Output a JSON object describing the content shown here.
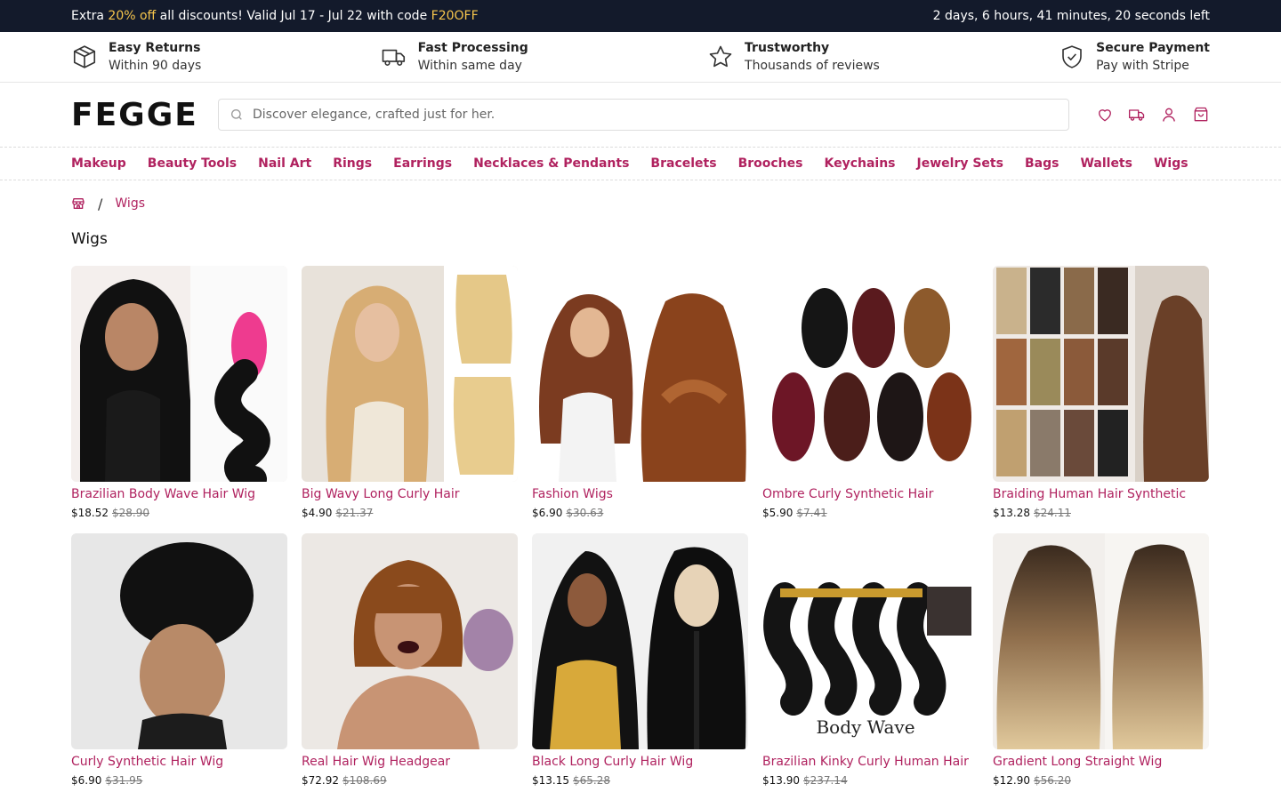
{
  "promo": {
    "pre": "Extra ",
    "discount": "20% off",
    "mid": " all discounts! Valid Jul 17 - Jul 22 with code ",
    "code": "F20OFF",
    "countdown": "2 days, 6 hours, 41 minutes, 20 seconds left"
  },
  "features": [
    {
      "title": "Easy Returns",
      "sub": "Within 90 days",
      "icon": "box-icon"
    },
    {
      "title": "Fast Processing",
      "sub": "Within same day",
      "icon": "truck-icon"
    },
    {
      "title": "Trustworthy",
      "sub": "Thousands of reviews",
      "icon": "star-icon"
    },
    {
      "title": "Secure Payment",
      "sub": "Pay with Stripe",
      "icon": "shield-icon"
    }
  ],
  "header": {
    "logo": "FEGGE",
    "search_placeholder": "Discover elegance, crafted just for her."
  },
  "nav": [
    "Makeup",
    "Beauty Tools",
    "Nail Art",
    "Rings",
    "Earrings",
    "Necklaces & Pendants",
    "Bracelets",
    "Brooches",
    "Keychains",
    "Jewelry Sets",
    "Bags",
    "Wallets",
    "Wigs"
  ],
  "breadcrumb": {
    "sep": "/",
    "current": "Wigs"
  },
  "page_title": "Wigs",
  "colors": {
    "accent": "#b0225f",
    "promo_bg": "#131a2b",
    "promo_highlight": "#f6c54c"
  },
  "products": [
    {
      "name": "Brazilian Body Wave Hair Wig",
      "price": "$18.52",
      "old": "$28.90"
    },
    {
      "name": "Big Wavy Long Curly Hair",
      "price": "$4.90",
      "old": "$21.37"
    },
    {
      "name": "Fashion Wigs",
      "price": "$6.90",
      "old": "$30.63"
    },
    {
      "name": "Ombre Curly Synthetic Hair",
      "price": "$5.90",
      "old": "$7.41"
    },
    {
      "name": "Braiding Human Hair Synthetic",
      "price": "$13.28",
      "old": "$24.11"
    },
    {
      "name": "Curly Synthetic Hair Wig",
      "price": "$6.90",
      "old": "$31.95"
    },
    {
      "name": "Real Hair Wig Headgear",
      "price": "$72.92",
      "old": "$108.69"
    },
    {
      "name": "Black Long Curly Hair Wig",
      "price": "$13.15",
      "old": "$65.28"
    },
    {
      "name": "Brazilian Kinky Curly Human Hair",
      "price": "$13.90",
      "old": "$237.14"
    },
    {
      "name": "Gradient Long Straight Wig",
      "price": "$12.90",
      "old": "$56.20"
    }
  ]
}
